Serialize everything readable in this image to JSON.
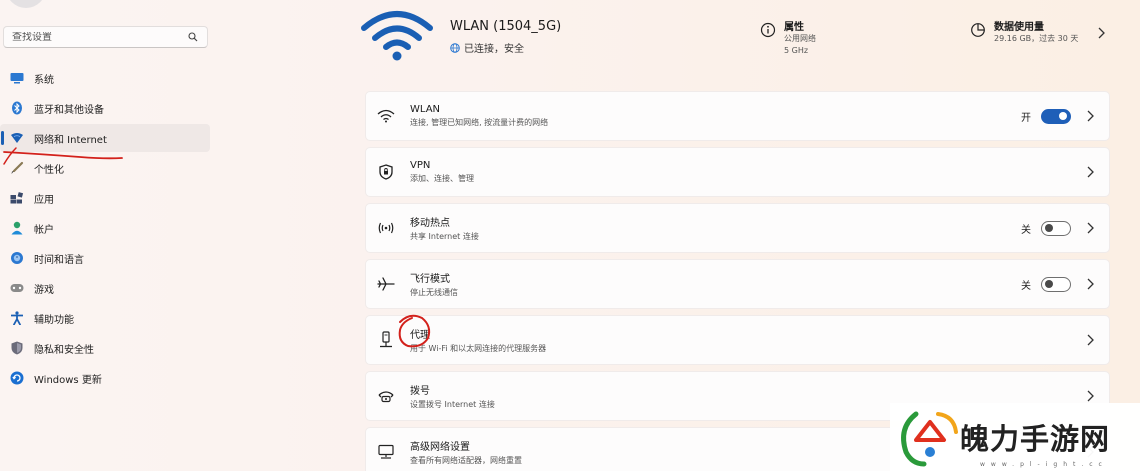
{
  "search": {
    "placeholder": "查找设置",
    "icon": "search-icon"
  },
  "sidebar": {
    "items": [
      {
        "label": "系统",
        "icon": "monitor-icon",
        "color": "#2b78d1"
      },
      {
        "label": "蓝牙和其他设备",
        "icon": "bluetooth-icon",
        "color": "#2b78d1"
      },
      {
        "label": "网络和 Internet",
        "icon": "wifi-diamond-icon",
        "color": "#1a5fb4",
        "active": true
      },
      {
        "label": "个性化",
        "icon": "brush-icon",
        "color": "#7a6a48"
      },
      {
        "label": "应用",
        "icon": "apps-icon",
        "color": "#3b4a6b"
      },
      {
        "label": "帐户",
        "icon": "person-icon",
        "color": "#2ba06a"
      },
      {
        "label": "时间和语言",
        "icon": "globe-clock-icon",
        "color": "#2b78d1"
      },
      {
        "label": "游戏",
        "icon": "gamepad-icon",
        "color": "#7a7a7a"
      },
      {
        "label": "辅助功能",
        "icon": "accessibility-icon",
        "color": "#1a5fb4"
      },
      {
        "label": "隐私和安全性",
        "icon": "shield-icon",
        "color": "#6b6b7a"
      },
      {
        "label": "Windows 更新",
        "icon": "update-icon",
        "color": "#1a6fd1"
      }
    ]
  },
  "header": {
    "network_name": "WLAN (1504_5G)",
    "status": "已连接，安全",
    "properties": {
      "title": "属性",
      "line1": "公用网络",
      "line2": "5 GHz"
    },
    "usage": {
      "title": "数据使用量",
      "line1": "29.16 GB，过去 30 天"
    }
  },
  "cards": [
    {
      "title": "WLAN",
      "subtitle": "连接, 管理已知网络, 按流量计费的网络",
      "icon": "wifi-icon",
      "toggle": {
        "label": "开",
        "state": "on"
      }
    },
    {
      "title": "VPN",
      "subtitle": "添加、连接、管理",
      "icon": "vpn-shield-icon"
    },
    {
      "title": "移动热点",
      "subtitle": "共享 Internet 连接",
      "icon": "hotspot-icon",
      "toggle": {
        "label": "关",
        "state": "off"
      }
    },
    {
      "title": "飞行模式",
      "subtitle": "停止无线通信",
      "icon": "airplane-icon",
      "toggle": {
        "label": "关",
        "state": "off"
      }
    },
    {
      "title": "代理",
      "subtitle": "用于 Wi-Fi 和以太网连接的代理服务器",
      "icon": "proxy-icon"
    },
    {
      "title": "拨号",
      "subtitle": "设置拨号 Internet 连接",
      "icon": "dialup-icon"
    },
    {
      "title": "高级网络设置",
      "subtitle": "查看所有网络适配器，网络重置",
      "icon": "advanced-network-icon"
    }
  ],
  "watermark": {
    "text": "魄力手游网",
    "sub": "www.pl-ight.cc"
  },
  "colors": {
    "accent": "#1f5fb8",
    "annotation_red": "#d3211b"
  }
}
